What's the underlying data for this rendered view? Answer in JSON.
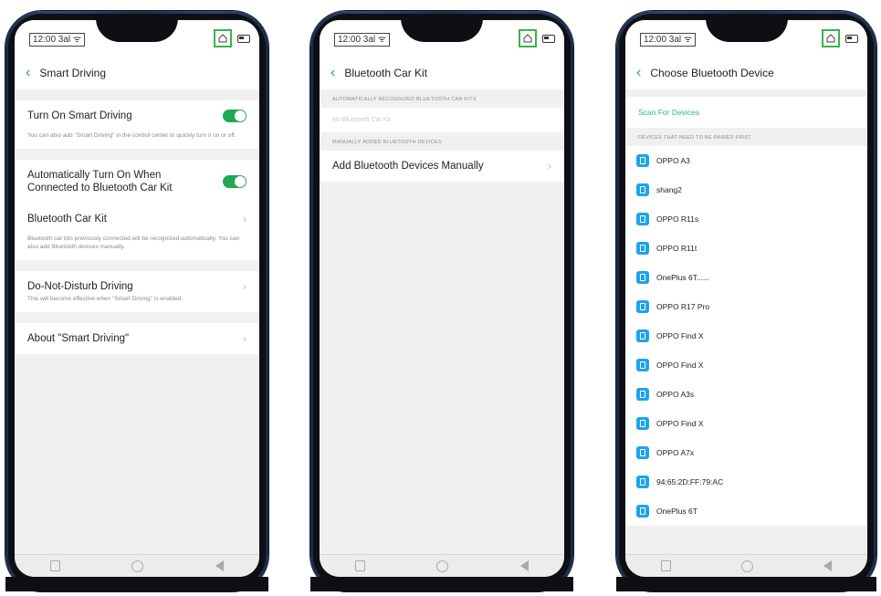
{
  "colors": {
    "accent": "#21a852",
    "highlight": "#39b54a",
    "device_icon": "#1ea3ec"
  },
  "status": {
    "time": "12:00 3al ᯤ"
  },
  "screen1": {
    "title": "Smart Driving",
    "turn_on_label": "Turn On Smart Driving",
    "turn_on_desc": "You can also add \"Smart Driving\" in the control center to quickly turn it on or off.",
    "auto_label": "Automatically Turn On When Connected to Bluetooth Car Kit",
    "car_kit_label": "Bluetooth Car Kit",
    "car_kit_desc": "Bluetooth car kits previously connected will be recognized automatically. You can also add Bluetooth devices manually.",
    "dnd_label": "Do-Not-Disturb Driving",
    "dnd_desc": "This will become effective when \"Smart Driving\" is enabled.",
    "about_label": "About \"Smart Driving\""
  },
  "screen2": {
    "title": "Bluetooth Car Kit",
    "auto_caption": "AUTOMATICALLY RECOGNIZED BLUETOOTH CAR KITS",
    "no_kit": "No Bluetooth Car Kit",
    "manual_caption": "MANUALLY ADDED BLUETOOTH DEVICES",
    "add_manual": "Add Bluetooth Devices Manually"
  },
  "screen3": {
    "title": "Choose Bluetooth Device",
    "scan": "Scan For Devices",
    "caption": "DEVICES THAT NEED TO BE PAIRED FIRST",
    "devices": [
      "OPPO A3",
      "shang2",
      "OPPO R11s",
      "OPPO R11t",
      "OnePlus 6T......",
      "OPPO R17 Pro",
      "OPPO Find X",
      "OPPO Find X",
      "OPPO A3s",
      "OPPO Find X",
      "OPPO A7x",
      "94:65:2D:FF:79:AC",
      "OnePlus 6T"
    ]
  }
}
